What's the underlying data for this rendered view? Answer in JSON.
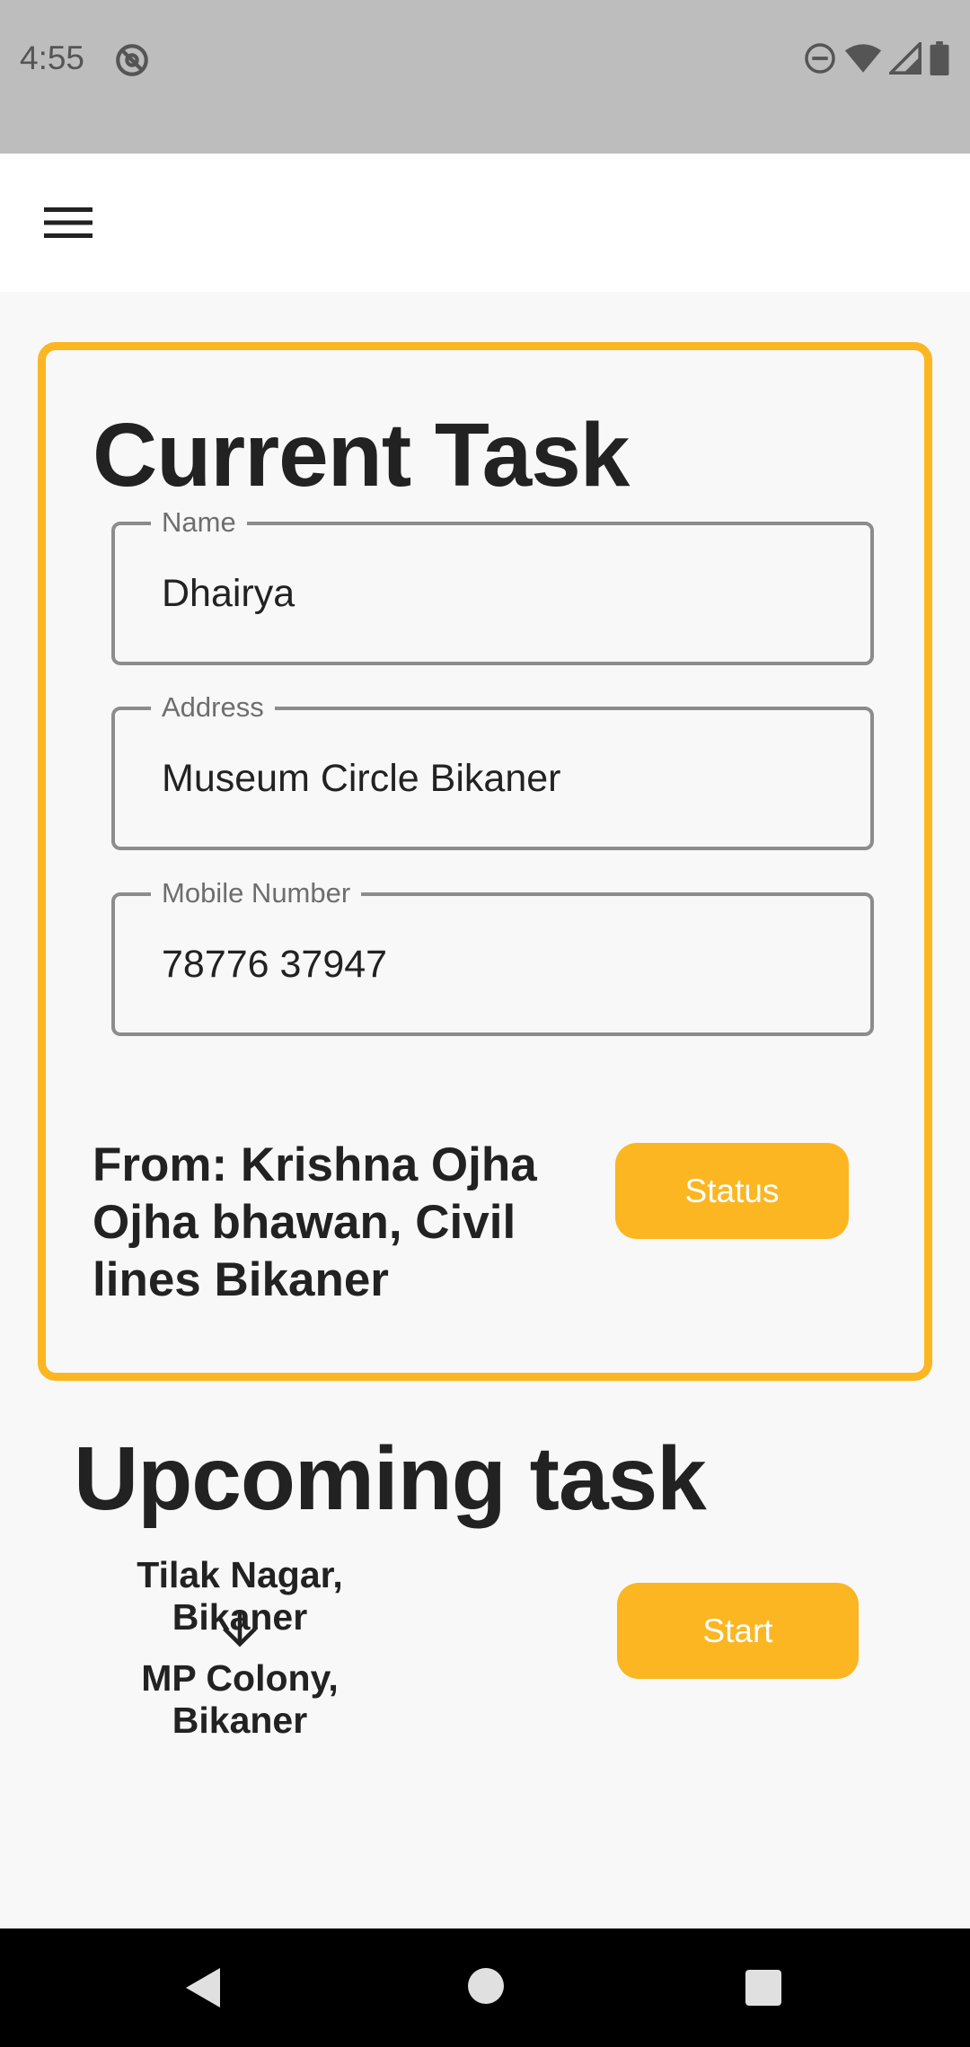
{
  "status_bar": {
    "time": "4:55",
    "icons": [
      "at-sign-icon",
      "do-not-disturb-icon",
      "wifi-icon",
      "signal-icon",
      "battery-icon"
    ]
  },
  "app_bar": {
    "menu_icon": "menu-icon"
  },
  "current_task": {
    "title": "Current Task",
    "fields": [
      {
        "label": "Name",
        "value": "Dhairya"
      },
      {
        "label": "Address",
        "value": "Museum Circle Bikaner"
      },
      {
        "label": "Mobile Number",
        "value": "78776 37947"
      }
    ],
    "from_text": "From: Krishna Ojha Ojha bhawan, Civil lines Bikaner",
    "status_button": "Status"
  },
  "upcoming_task": {
    "title": "Upcoming task",
    "route_from": "Tilak Nagar, Bikaner",
    "route_to": "MP Colony, Bikaner",
    "arrow_icon": "arrow-down-icon",
    "start_button": "Start"
  },
  "nav_bar": {
    "icons": [
      "back-icon",
      "home-icon",
      "recents-icon"
    ]
  },
  "colors": {
    "accent": "#fbb622",
    "status_bar": "#bdbdbd",
    "field_border": "#8c8c8c",
    "nav_bar": "#000000"
  }
}
